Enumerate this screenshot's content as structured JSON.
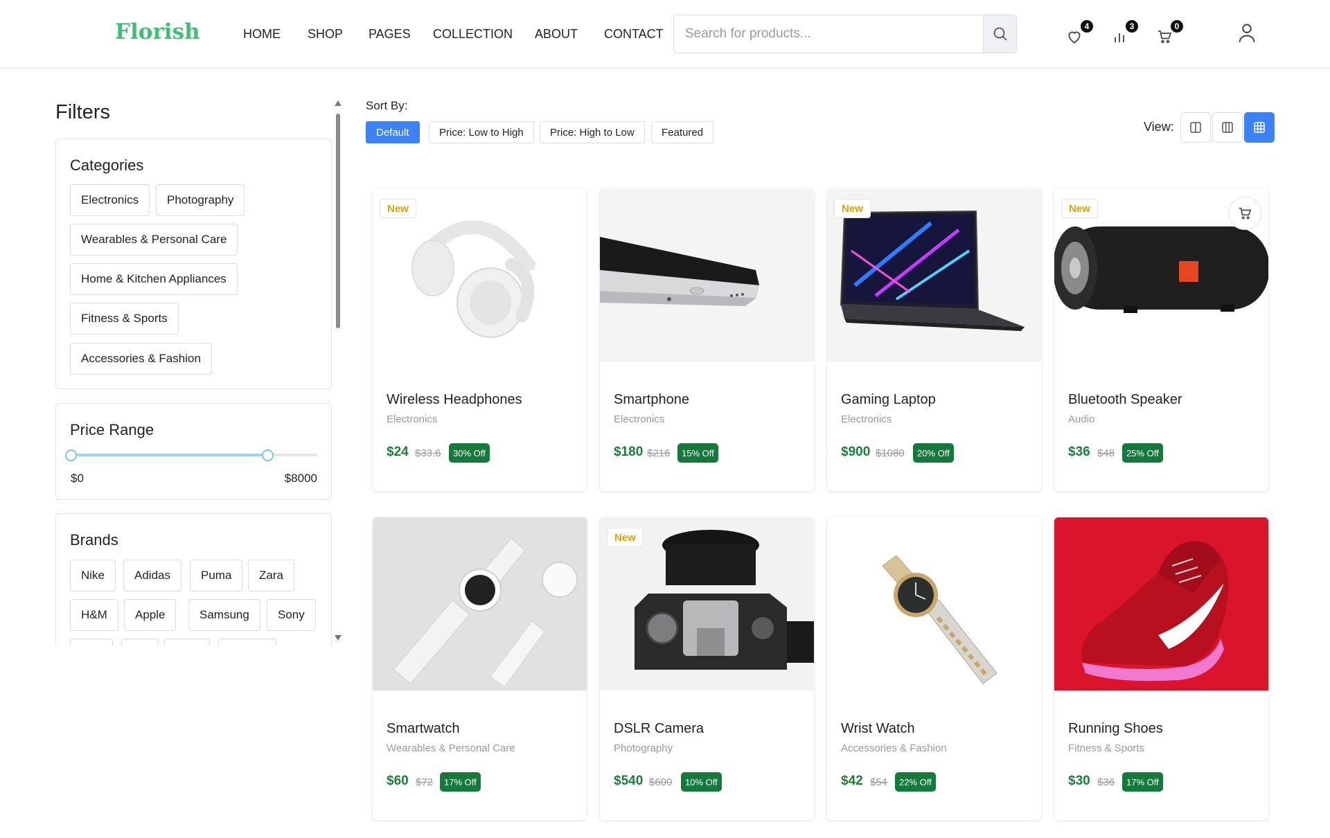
{
  "header": {
    "logo": "Florish",
    "nav": [
      "HOME",
      "SHOP",
      "PAGES",
      "COLLECTION",
      "ABOUT",
      "CONTACT"
    ],
    "search_placeholder": "Search for products...",
    "wishlist_count": "4",
    "compare_count": "3",
    "cart_count": "0"
  },
  "filters": {
    "title": "Filters",
    "categories_title": "Categories",
    "categories": [
      "Electronics",
      "Photography",
      "Wearables & Personal Care",
      "Home & Kitchen Appliances",
      "Fitness & Sports",
      "Accessories & Fashion"
    ],
    "price_title": "Price Range",
    "price_min": "$0",
    "price_max": "$8000",
    "price_slider_fraction": 0.8,
    "brands_title": "Brands",
    "brands": [
      "Nike",
      "Adidas",
      "Puma",
      "Zara",
      "H&M",
      "Apple",
      "Samsung",
      "Sony"
    ]
  },
  "sort": {
    "label": "Sort By:",
    "options": [
      "Default",
      "Price: Low to High",
      "Price: High to Low",
      "Featured"
    ],
    "active": "Default"
  },
  "view": {
    "label": "View:",
    "active": "grid-4"
  },
  "products": [
    {
      "name": "Wireless Headphones",
      "category": "Electronics",
      "price": "$24",
      "old_price": "$33.6",
      "discount": "30% Off",
      "new": "New"
    },
    {
      "name": "Smartphone",
      "category": "Electronics",
      "price": "$180",
      "old_price": "$216",
      "discount": "15% Off",
      "new": ""
    },
    {
      "name": "Gaming Laptop",
      "category": "Electronics",
      "price": "$900",
      "old_price": "$1080",
      "discount": "20% Off",
      "new": "New"
    },
    {
      "name": "Bluetooth Speaker",
      "category": "Audio",
      "price": "$36",
      "old_price": "$48",
      "discount": "25% Off",
      "new": "New"
    },
    {
      "name": "Smartwatch",
      "category": "Wearables & Personal Care",
      "price": "$60",
      "old_price": "$72",
      "discount": "17% Off",
      "new": ""
    },
    {
      "name": "DSLR Camera",
      "category": "Photography",
      "price": "$540",
      "old_price": "$600",
      "discount": "10% Off",
      "new": "New"
    },
    {
      "name": "Wrist Watch",
      "category": "Accessories & Fashion",
      "price": "$42",
      "old_price": "$54",
      "discount": "22% Off",
      "new": ""
    },
    {
      "name": "Running Shoes",
      "category": "Fitness & Sports",
      "price": "$30",
      "old_price": "$36",
      "discount": "17% Off",
      "new": ""
    }
  ],
  "colors": {
    "brand": "#3fbf74",
    "accent": "#3b82f6",
    "price": "#1a7f37",
    "discount_badge": "#137a3b",
    "new_tag": "#e0a300"
  }
}
